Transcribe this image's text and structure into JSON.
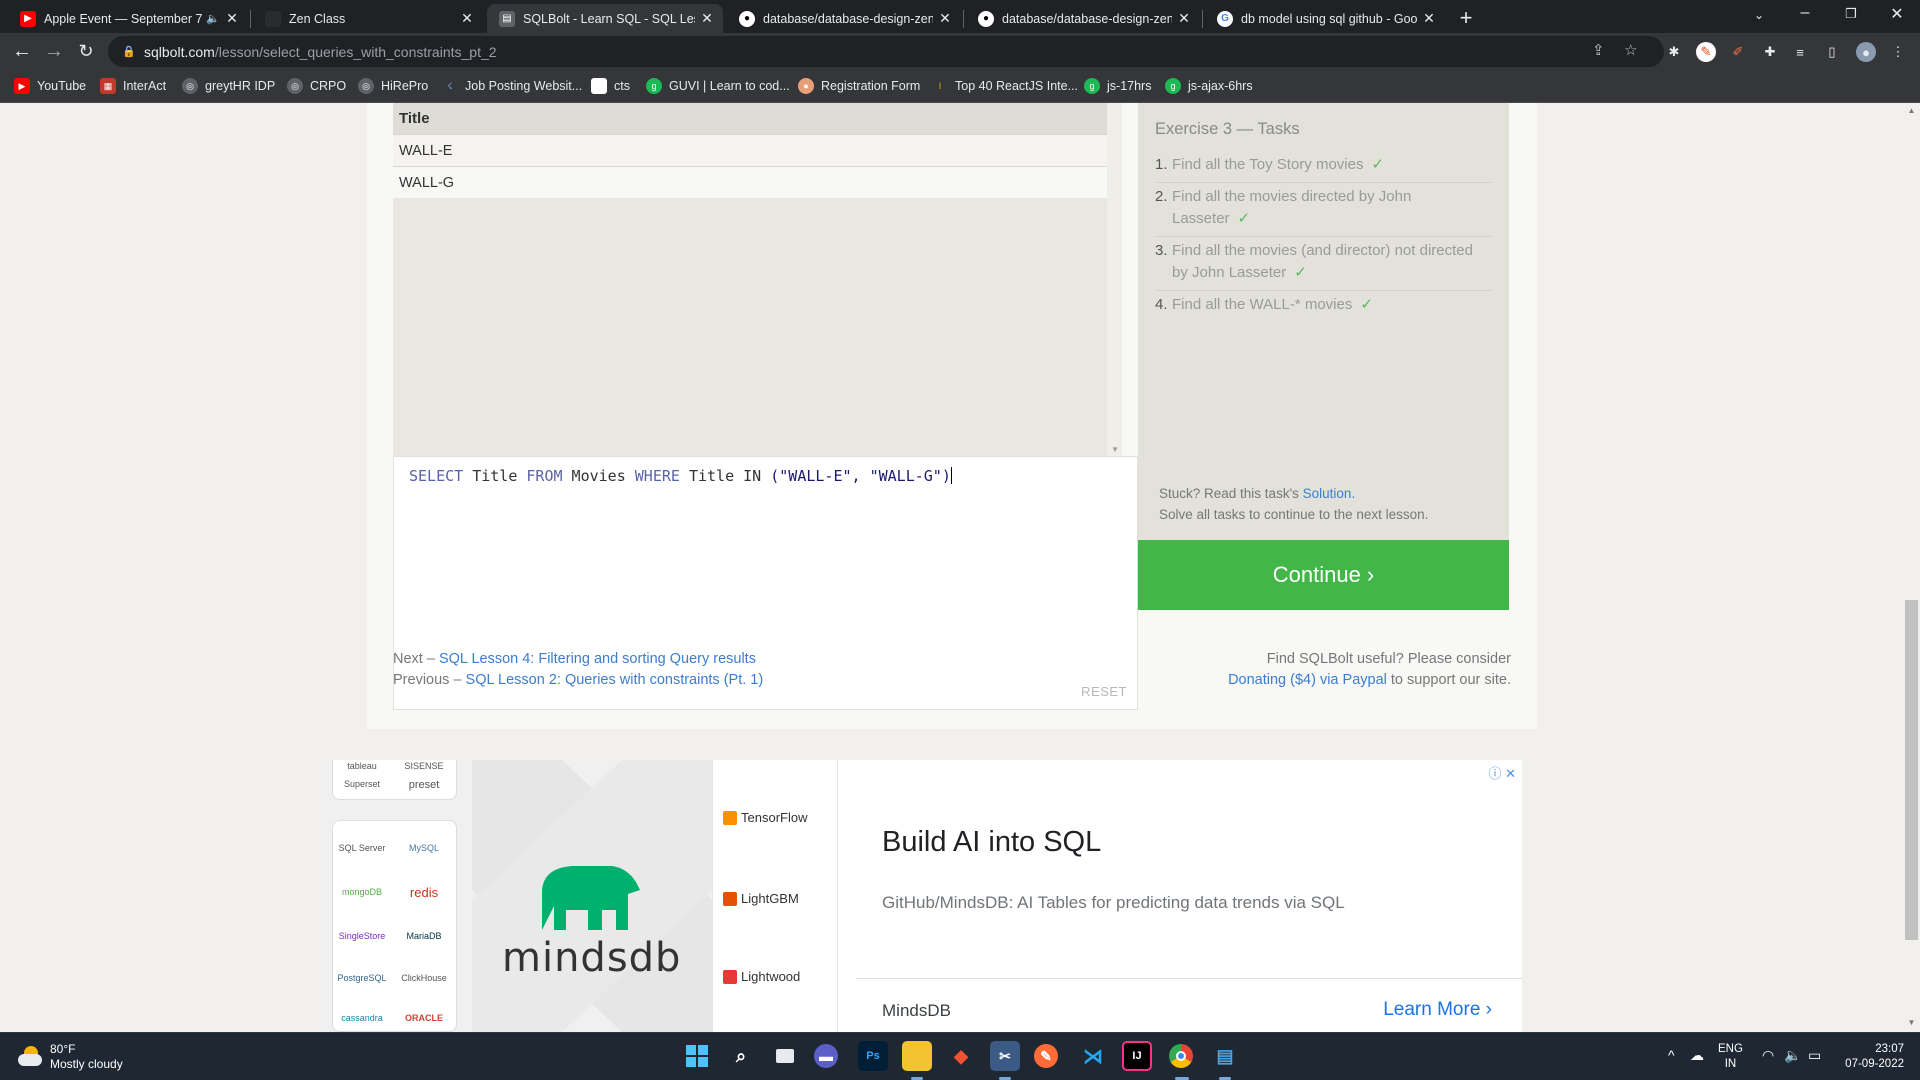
{
  "browser": {
    "tabs": [
      {
        "title": "Apple Event — September 7",
        "audio": true,
        "icon": "youtube-icon",
        "color": "#ff0000"
      },
      {
        "title": "Zen Class",
        "icon": "zen-class-icon",
        "color": "#202124"
      },
      {
        "title": "SQLBolt - Learn SQL - SQL Lesson",
        "icon": "sqlbolt-icon",
        "color": "#5f6368"
      },
      {
        "title": "database/database-design-zen-c",
        "icon": "github-icon",
        "color": "#ffffff"
      },
      {
        "title": "database/database-design-zen-c",
        "icon": "github-icon",
        "color": "#ffffff"
      },
      {
        "title": "db model using sql github - Goo",
        "icon": "google-icon",
        "color": "#ffffff"
      }
    ],
    "url_host": "sqlbolt.com",
    "url_path": "/lesson/select_queries_with_constraints_pt_2",
    "bookmarks": [
      "YouTube",
      "InterAct",
      "greytHR IDP",
      "CRPO",
      "HiRePro",
      "Job Posting Websit...",
      "cts",
      "GUVI | Learn to cod...",
      "Registration Form",
      "Top 40 ReactJS Inte...",
      "js-17hrs",
      "js-ajax-6hrs"
    ]
  },
  "results": {
    "column": "Title",
    "rows": [
      "WALL-E",
      "WALL-G"
    ]
  },
  "editor": {
    "query_kw1": "SELECT",
    "query_id1": " Title ",
    "query_kw2": "FROM",
    "query_id2": " Movies ",
    "query_kw3": "WHERE",
    "query_id3": " Title IN ",
    "query_args": "(\"WALL-E\", \"WALL-G\")",
    "reset_label": "RESET"
  },
  "tasks": {
    "title": "Exercise 3 — Tasks",
    "items": [
      {
        "num": "1.",
        "text": "Find all the Toy Story movies",
        "done": "✓"
      },
      {
        "num": "2.",
        "text": "Find all the movies directed by John Lasseter",
        "done": "✓"
      },
      {
        "num": "3.",
        "text": "Find all the movies (and director) not directed by John Lasseter",
        "done": "✓"
      },
      {
        "num": "4.",
        "text": "Find all the WALL-* movies",
        "done": "✓"
      }
    ],
    "stuck_prefix": "Stuck? Read this task's ",
    "solution_link": "Solution.",
    "solve_all": "Solve all tasks to continue to the next lesson.",
    "continue_label": "Continue ›"
  },
  "footer_nav": {
    "next_prefix": "Next – ",
    "next_link": "SQL Lesson 4: Filtering and sorting Query results",
    "prev_prefix": "Previous – ",
    "prev_link": "SQL Lesson 2: Queries with constraints (Pt. 1)",
    "donate_line1": "Find SQLBolt useful? Please consider",
    "donate_link": "Donating ($4) via Paypal",
    "donate_suffix": " to support our site."
  },
  "ad": {
    "logos": [
      "tableau",
      "SISENSE",
      "Superset",
      "preset",
      "SQL Server",
      "MySQL",
      "mongoDB",
      "redis",
      "SingleStore",
      "MariaDB",
      "PostgreSQL",
      "ClickHouse",
      "cassandra",
      "ORACLE"
    ],
    "brand_word": "mindsdb",
    "frameworks": [
      "TensorFlow",
      "LightGBM",
      "Lightwood"
    ],
    "headline": "Build AI into SQL",
    "description": "GitHub/MindsDB: AI Tables for predicting data trends via SQL",
    "advertiser": "MindsDB",
    "cta": "Learn More",
    "badge": "ⓘ ✕",
    "brand_color": "#00b06d"
  },
  "taskbar": {
    "temperature": "80°F",
    "weather": "Mostly cloudy",
    "lang_line1": "ENG",
    "lang_line2": "IN",
    "time": "23:07",
    "date": "07-09-2022"
  }
}
